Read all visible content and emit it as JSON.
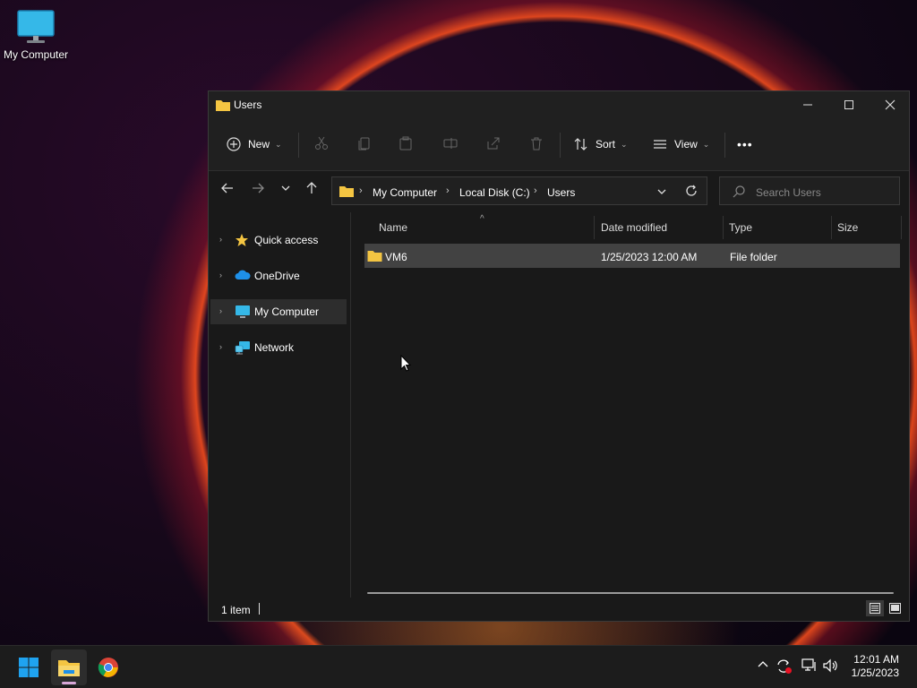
{
  "desktop": {
    "icon_label": "My Computer"
  },
  "window": {
    "title": "Users",
    "controls": {
      "minimize": "—",
      "maximize": "☐",
      "close": "✕"
    }
  },
  "toolbar": {
    "new_label": "New",
    "sort_label": "Sort",
    "view_label": "View",
    "more_label": "•••"
  },
  "address": {
    "crumbs": [
      "My Computer",
      "Local Disk (C:)",
      "Users"
    ],
    "separator": "›"
  },
  "search": {
    "placeholder": "Search Users"
  },
  "sidebar": {
    "items": [
      {
        "label": "Quick access",
        "icon": "star-icon"
      },
      {
        "label": "OneDrive",
        "icon": "cloud-icon"
      },
      {
        "label": "My Computer",
        "icon": "monitor-icon",
        "selected": true
      },
      {
        "label": "Network",
        "icon": "network-icon"
      }
    ]
  },
  "columns": [
    "Name",
    "Date modified",
    "Type",
    "Size"
  ],
  "rows": [
    {
      "name": "VM6",
      "date": "1/25/2023 12:00 AM",
      "type": "File folder",
      "size": ""
    }
  ],
  "status": {
    "count": "1 item"
  },
  "taskbar": {
    "time": "12:01 AM",
    "date": "1/25/2023"
  },
  "colors": {
    "accent": "#4cc2ff",
    "folder": "#f4c542",
    "selected_row": "#424242"
  }
}
